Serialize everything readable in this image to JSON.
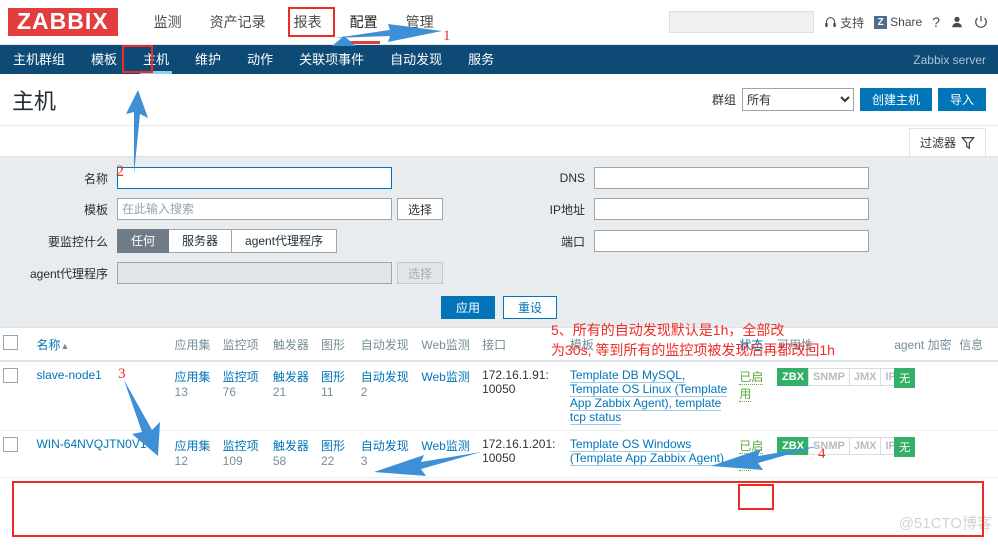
{
  "brand": {
    "logo": "ZABBIX"
  },
  "topnav": {
    "items": [
      {
        "label": "监测",
        "selected": false
      },
      {
        "label": "资产记录",
        "selected": false
      },
      {
        "label": "报表",
        "selected": false
      },
      {
        "label": "配置",
        "selected": true
      },
      {
        "label": "管理",
        "selected": false
      }
    ],
    "search_placeholder": "",
    "search_value": "",
    "support_label": "支持",
    "share_label": "Share",
    "share_badge": "Z",
    "help_label": "?",
    "user_icon": "user-icon",
    "signout_icon": "power-icon"
  },
  "subnav": {
    "items": [
      {
        "label": "主机群组",
        "selected": false
      },
      {
        "label": "模板",
        "selected": false
      },
      {
        "label": "主机",
        "selected": true
      },
      {
        "label": "维护",
        "selected": false
      },
      {
        "label": "动作",
        "selected": false
      },
      {
        "label": "关联项事件",
        "selected": false
      },
      {
        "label": "自动发现",
        "selected": false
      },
      {
        "label": "服务",
        "selected": false
      }
    ],
    "server": "Zabbix server"
  },
  "page": {
    "title": "主机",
    "group_label": "群组",
    "group_value": "所有",
    "create_host_label": "创建主机",
    "import_label": "导入",
    "filter_tab_label": "过滤器",
    "filter_icon": "funnel-icon"
  },
  "filter": {
    "name_label": "名称",
    "name_value": "",
    "template_label": "模板",
    "template_placeholder": "在此输入搜索",
    "template_value": "",
    "select_label": "选择",
    "monitored_by_label": "要监控什么",
    "monitored_by_options": [
      "任何",
      "服务器",
      "agent代理程序"
    ],
    "monitored_by_selected": "任何",
    "proxy_label": "agent代理程序",
    "proxy_value": "",
    "proxy_select_label": "选择",
    "dns_label": "DNS",
    "dns_value": "",
    "ip_label": "IP地址",
    "ip_value": "",
    "port_label": "端口",
    "port_value": "",
    "apply_label": "应用",
    "reset_label": "重设"
  },
  "table": {
    "headers": {
      "name": "名称",
      "sort": "▲",
      "applications": "应用集",
      "items": "监控项",
      "triggers": "触发器",
      "graphs": "图形",
      "discovery": "自动发现",
      "web": "Web监测",
      "interface": "接口",
      "templates": "模板",
      "status": "状态",
      "availability": "可用性",
      "encryption": "agent 加密",
      "info": "信息"
    },
    "rows": [
      {
        "name": "slave-node1",
        "applications_label": "应用集",
        "applications_count": "13",
        "items_label": "监控项",
        "items_count": "76",
        "triggers_label": "触发器",
        "triggers_count": "21",
        "graphs_label": "图形",
        "graphs_count": "11",
        "discovery_label": "自动发现",
        "discovery_count": "2",
        "web_label": "Web监测",
        "interface": "172.16.1.91: 10050",
        "templates": "Template DB MySQL, Template OS Linux (Template App Zabbix Agent), template tcp status",
        "status": "已启用",
        "availability": [
          {
            "label": "ZBX",
            "active": true
          },
          {
            "label": "SNMP",
            "active": false
          },
          {
            "label": "JMX",
            "active": false
          },
          {
            "label": "IPMI",
            "active": false
          }
        ],
        "encryption": "无",
        "highlighted": false
      },
      {
        "name": "WIN-64NVQJTN0V1",
        "applications_label": "应用集",
        "applications_count": "12",
        "items_label": "监控项",
        "items_count": "109",
        "triggers_label": "触发器",
        "triggers_count": "58",
        "graphs_label": "图形",
        "graphs_count": "22",
        "discovery_label": "自动发现",
        "discovery_count": "3",
        "web_label": "Web监测",
        "interface": "172.16.1.201: 10050",
        "templates": "Template OS Windows (Template App Zabbix Agent)",
        "status": "已启用",
        "availability": [
          {
            "label": "ZBX",
            "active": true
          },
          {
            "label": "SNMP",
            "active": false
          },
          {
            "label": "JMX",
            "active": false
          },
          {
            "label": "IPMI",
            "active": false
          }
        ],
        "encryption": "无",
        "highlighted": true
      }
    ]
  },
  "annotations": {
    "n1": "1",
    "n2": "2",
    "n3": "3",
    "n4": "4",
    "note_line1": "5、所有的自动发现默认是1h，全部改",
    "note_line2": "为30s, 等到所有的监控项被发现后再都改回1h"
  },
  "watermark": "@51CTO博客",
  "colors": {
    "brand_red": "#e33e3e",
    "nav_blue": "#0d4a76",
    "accent_blue": "#0275b8",
    "green": "#34af67",
    "annotation_red": "#ee2b26"
  }
}
